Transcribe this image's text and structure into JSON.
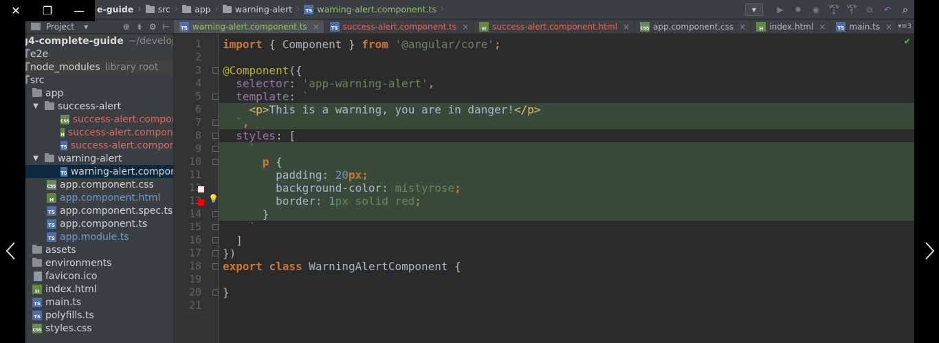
{
  "viewer": {
    "close_icon": "close-icon",
    "restore_icon": "restore-icon",
    "minimize_icon": "minimize-icon"
  },
  "breadcrumb": [
    {
      "label": "e-guide",
      "kind": "root"
    },
    {
      "label": "src",
      "kind": "folder"
    },
    {
      "label": "app",
      "kind": "folder"
    },
    {
      "label": "warning-alert",
      "kind": "folder"
    },
    {
      "label": "warning-alert.component.ts",
      "kind": "ts"
    }
  ],
  "project_panel": {
    "title": "Project"
  },
  "tabs": [
    {
      "label": "warning-alert.component.ts",
      "type": "ts",
      "active": true
    },
    {
      "label": "success-alert.component.ts",
      "type": "ts",
      "active": false
    },
    {
      "label": "success-alert.component.html",
      "type": "html",
      "active": false
    },
    {
      "label": "app.component.css",
      "type": "css",
      "active": false
    },
    {
      "label": "index.html",
      "type": "html",
      "active": false
    },
    {
      "label": "main.ts",
      "type": "ts",
      "active": false
    }
  ],
  "tabs_overflow": "3",
  "tree": [
    {
      "label": "g4-complete-guide",
      "note": "~/development",
      "depth": 0,
      "kind": "root"
    },
    {
      "label": "e2e",
      "depth": 0,
      "kind": "folder"
    },
    {
      "label": "node_modules",
      "note": "library root",
      "depth": 0,
      "kind": "lib"
    },
    {
      "label": "src",
      "depth": 0,
      "kind": "folder"
    },
    {
      "label": "app",
      "depth": 1,
      "kind": "folder"
    },
    {
      "label": "success-alert",
      "depth": 2,
      "kind": "folder-open"
    },
    {
      "label": "success-alert.componen",
      "depth": 3,
      "kind": "css",
      "color": "red"
    },
    {
      "label": "success-alert.componen",
      "depth": 3,
      "kind": "html",
      "color": "red"
    },
    {
      "label": "success-alert.componen",
      "depth": 3,
      "kind": "ts",
      "color": "red"
    },
    {
      "label": "warning-alert",
      "depth": 2,
      "kind": "folder-open"
    },
    {
      "label": "warning-alert.componen",
      "depth": 3,
      "kind": "ts",
      "selected": true
    },
    {
      "label": "app.component.css",
      "depth": 2,
      "kind": "css"
    },
    {
      "label": "app.component.html",
      "depth": 2,
      "kind": "html",
      "color": "blue"
    },
    {
      "label": "app.component.spec.ts",
      "depth": 2,
      "kind": "ts"
    },
    {
      "label": "app.component.ts",
      "depth": 2,
      "kind": "ts"
    },
    {
      "label": "app.module.ts",
      "depth": 2,
      "kind": "ts",
      "color": "blue"
    },
    {
      "label": "assets",
      "depth": 1,
      "kind": "folder"
    },
    {
      "label": "environments",
      "depth": 1,
      "kind": "folder"
    },
    {
      "label": "favicon.ico",
      "depth": 1,
      "kind": "file"
    },
    {
      "label": "index.html",
      "depth": 1,
      "kind": "html"
    },
    {
      "label": "main.ts",
      "depth": 1,
      "kind": "ts"
    },
    {
      "label": "polyfills.ts",
      "depth": 1,
      "kind": "ts"
    },
    {
      "label": "styles.css",
      "depth": 1,
      "kind": "css"
    }
  ],
  "code": {
    "line_numbers": [
      "1",
      "2",
      "3",
      "4",
      "5",
      "6",
      "7",
      "8",
      "9",
      "10",
      "11",
      "12",
      "13",
      "14",
      "15",
      "16",
      "17",
      "18",
      "19",
      "20",
      "21"
    ],
    "l1": {
      "kw": "import",
      "a": " { Component } ",
      "kw2": "from",
      "sp": " ",
      "str": "'@angular/core'",
      "end": ";"
    },
    "l3": {
      "ann": "@Component",
      "rest": "({"
    },
    "l4": {
      "ind": "  ",
      "prop": "selector",
      "colon": ": ",
      "str": "'app-warning-alert'",
      "end": ","
    },
    "l5": {
      "ind": "  ",
      "prop": "template",
      "colon": ": ",
      "str": "`"
    },
    "l6": {
      "ind": "    ",
      "open": "<p>",
      "text": "This is a warning, you are in danger!",
      "close": "</p>"
    },
    "l7": {
      "ind": "  ",
      "str": "`",
      "end": ","
    },
    "l8": {
      "ind": "  ",
      "prop": "styles",
      "rest": ": ["
    },
    "l9": {
      "ind": "    ",
      "str": "`"
    },
    "l10": {
      "ind": "      ",
      "sel": "p",
      "rest": " {"
    },
    "l11": {
      "ind": "        ",
      "p": "padding",
      "c": ": ",
      "num": "20",
      "unit": "px",
      "end": ";"
    },
    "l12": {
      "ind": "        ",
      "p": "background-color",
      "c": ": ",
      "val": "mistyrose",
      "end": ";"
    },
    "l13": {
      "ind": "        ",
      "p": "border",
      "c": ": ",
      "num": "1",
      "val": "px solid red",
      "end": ";"
    },
    "l14": {
      "ind": "      ",
      "rest": "}"
    },
    "l15": {
      "ind": "    ",
      "str": "`"
    },
    "l16": {
      "ind": "  ",
      "rest": "]"
    },
    "l17": {
      "rest": "})"
    },
    "l18": {
      "kw": "export",
      "sp": " ",
      "kw2": "class",
      "name": " WarningAlertComponent {"
    },
    "l20": {
      "rest": "}"
    }
  },
  "colors": {
    "color_mistyrose": "#ffe4e1",
    "color_red": "#ff0000"
  }
}
